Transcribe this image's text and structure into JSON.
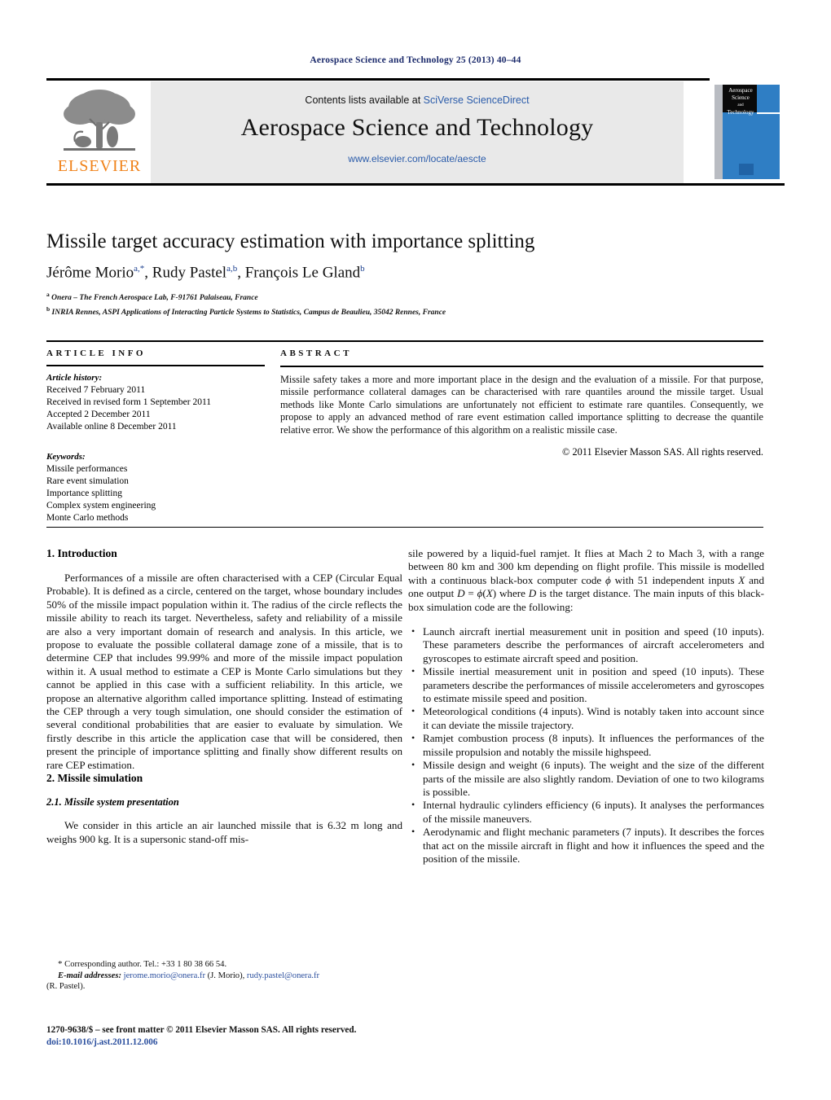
{
  "running_head": "Aerospace Science and Technology 25 (2013) 40–44",
  "masthead": {
    "contents_prefix": "Contents lists available at",
    "sciencedirect_link": "SciVerse ScienceDirect",
    "journal_title": "Aerospace Science and Technology",
    "journal_url": "www.elsevier.com/locate/aescte",
    "publisher_logo_text": "ELSEVIER",
    "cover_title_line1": "Aerospace",
    "cover_title_line2": "Science",
    "cover_title_line3": "and",
    "cover_title_line4": "Technology"
  },
  "paper": {
    "title": "Missile target accuracy estimation with importance splitting",
    "authors_html": "Jérôme Morio<sup>a,*</sup>, Rudy Pastel<sup>a,b</sup>, François Le Gland<sup>b</sup>",
    "affiliation_a": "Onera – The French Aerospace Lab, F-91761 Palaiseau, France",
    "affiliation_b": "INRIA Rennes, ASPI Applications of Interacting Particle Systems to Statistics, Campus de Beaulieu, 35042 Rennes, France"
  },
  "article_info": {
    "heading": "ARTICLE INFO",
    "history_label": "Article history:",
    "history": [
      "Received 7 February 2011",
      "Received in revised form 1 September 2011",
      "Accepted 2 December 2011",
      "Available online 8 December 2011"
    ],
    "keywords_label": "Keywords:",
    "keywords": [
      "Missile performances",
      "Rare event simulation",
      "Importance splitting",
      "Complex system engineering",
      "Monte Carlo methods"
    ]
  },
  "abstract": {
    "heading": "ABSTRACT",
    "text": "Missile safety takes a more and more important place in the design and the evaluation of a missile. For that purpose, missile performance collateral damages can be characterised with rare quantiles around the missile target. Usual methods like Monte Carlo simulations are unfortunately not efficient to estimate rare quantiles. Consequently, we propose to apply an advanced method of rare event estimation called importance splitting to decrease the quantile relative error. We show the performance of this algorithm on a realistic missile case.",
    "copyright": "© 2011 Elsevier Masson SAS. All rights reserved."
  },
  "body": {
    "section1_heading": "1. Introduction",
    "section1_para1": "Performances of a missile are often characterised with a CEP (Circular Equal Probable). It is defined as a circle, centered on the target, whose boundary includes 50% of the missile impact population within it. The radius of the circle reflects the missile ability to reach its target. Nevertheless, safety and reliability of a missile are also a very important domain of research and analysis. In this article, we propose to evaluate the possible collateral damage zone of a missile, that is to determine CEP that includes 99.99% and more of the missile impact population within it. A usual method to estimate a CEP is Monte Carlo simulations but they cannot be applied in this case with a sufficient reliability. In this article, we propose an alternative algorithm called importance splitting. Instead of estimating the CEP through a very tough simulation, one should consider the estimation of several conditional probabilities that are easier to evaluate by simulation. We firstly describe in this article the application case that will be considered, then present the principle of importance splitting and finally show different results on rare CEP estimation.",
    "section2_heading": "2. Missile simulation",
    "section21_heading": "2.1. Missile system presentation",
    "section21_para1_left": "We consider in this article an air launched missile that is 6.32 m long and weighs 900 kg. It is a supersonic stand-off mis-",
    "section21_para1_right_html": "sile powered by a liquid-fuel ramjet. It flies at Mach 2 to Mach 3, with a range between 80 km and 300 km depending on flight profile. This missile is modelled with a continuous black-box computer code <span class=\"math-it\">ϕ</span> with 51 independent inputs <span class=\"math-it\">X</span> and one output <span class=\"math-it\">D</span> = <span class=\"math-it\">ϕ</span>(<span class=\"math-it\">X</span>) where <span class=\"math-it\">D</span> is the target distance. The main inputs of this black-box simulation code are the following:",
    "bullets": [
      "Launch aircraft inertial measurement unit in position and speed (10 inputs). These parameters describe the performances of aircraft accelerometers and gyroscopes to estimate aircraft speed and position.",
      "Missile inertial measurement unit in position and speed (10 inputs). These parameters describe the performances of missile accelerometers and gyroscopes to estimate missile speed and position.",
      "Meteorological conditions (4 inputs). Wind is notably taken into account since it can deviate the missile trajectory.",
      "Ramjet combustion process (8 inputs). It influences the performances of the missile propulsion and notably the missile highspeed.",
      "Missile design and weight (6 inputs). The weight and the size of the different parts of the missile are also slightly random. Deviation of one to two kilograms is possible.",
      "Internal hydraulic cylinders efficiency (6 inputs). It analyses the performances of the missile maneuvers.",
      "Aerodynamic and flight mechanic parameters (7 inputs). It describes the forces that act on the missile aircraft in flight and how it influences the speed and the position of the missile."
    ]
  },
  "footnote": {
    "corresponding_author": "Corresponding author. Tel.: +33 1 80 38 66 54.",
    "email_label": "E-mail addresses:",
    "email1": "jerome.morio@onera.fr",
    "email1_owner": "(J. Morio),",
    "email2": "rudy.pastel@onera.fr",
    "email2_owner": "(R. Pastel)."
  },
  "copyright_footer": {
    "issn_line": "1270-9638/$ – see front matter © 2011 Elsevier Masson SAS. All rights reserved.",
    "doi": "doi:10.1016/j.ast.2011.12.006"
  }
}
